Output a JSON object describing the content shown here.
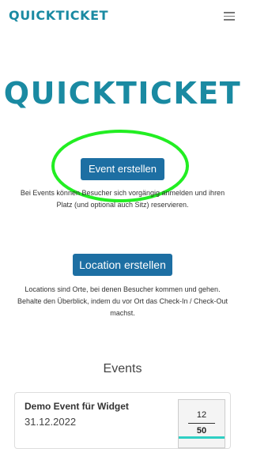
{
  "header": {
    "brand": "QUICKTICKET",
    "menu_icon": "hamburger-menu-icon"
  },
  "hero": {
    "logo_text": "QUICKTICKET"
  },
  "event_section": {
    "button_label": "Event erstellen",
    "description": "Bei Events können Besucher sich vorgängig anmelden und ihren Platz (und optional auch Sitz) reservieren.",
    "highlight_color": "#22ee22"
  },
  "location_section": {
    "button_label": "Location erstellen",
    "description": "Locations sind Orte, bei denen Besucher kommen und gehen. Behalte den Überblick, indem du vor Ort das Check-In / Check-Out machst."
  },
  "events": {
    "title": "Events",
    "items": [
      {
        "name": "Demo Event für Widget",
        "date": "31.12.2022",
        "count_current": "12",
        "count_total": "50",
        "fill_fraction": 0.24
      }
    ]
  },
  "colors": {
    "brand": "#1a8aa2",
    "button": "#1d6fa3",
    "progress": "#2fcfc4"
  }
}
